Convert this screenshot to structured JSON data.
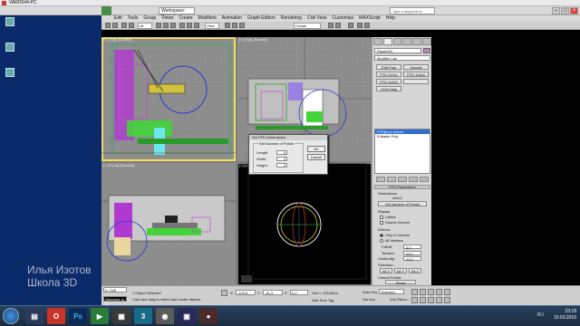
{
  "remote_window": {
    "title": "VARD644-PC"
  },
  "app": {
    "workspace": "Workspace: Default",
    "search_placeholder": "Type a keyword or phrase"
  },
  "menu": [
    "Edit",
    "Tools",
    "Group",
    "Views",
    "Create",
    "Modifiers",
    "Animation",
    "Graph Editors",
    "Rendering",
    "Civil View",
    "Customize",
    "MAXScript",
    "Help"
  ],
  "toolbar": {
    "selection_filter": "All",
    "view_dropdown": "View",
    "selection_set": "Create Selection Se"
  },
  "viewports": {
    "top_left": "[+] [Top] [Shaded]",
    "top_right": "[+] [Top] [Shaded]",
    "bottom_left": "[+] [Front] [Shaded]",
    "bottom_right": "[+] [Left] [Wireframe]",
    "left_strip_labels": [
      "[+] [Persp] [Default Shading]"
    ]
  },
  "command_panel": {
    "object_name": "Plane004",
    "modifier_list": "Modifier List",
    "buttons": [
      "Edit Poly",
      "Smooth",
      "FFD 2x2x2",
      "FFD 4x4x4",
      "FFD 3x3x3",
      "",
      "UVW Map"
    ],
    "stack": [
      {
        "label": "FFD(box) 4x4x4",
        "selected": true
      },
      {
        "label": "Editable Poly",
        "selected": false
      }
    ],
    "ffd_params": {
      "title": "FFD Parameters",
      "dimensions_label": "Dimensions:",
      "dims_value": "4x4x4",
      "set_points_button": "Set Number of Points",
      "display_label": "Display:",
      "lattice": "Lattice",
      "source_volume": "Source Volume",
      "deform_label": "Deform:",
      "only_in_volume": "Only In Volume",
      "all_vertices": "All Vertices",
      "falloff_label": "Falloff:",
      "falloff_value": "0,0",
      "tension_label": "Tension:",
      "tension_value": "25,0",
      "continuity_label": "Continuity:",
      "continuity_value": "25,0",
      "selection_label": "Selection:",
      "sel_buttons": [
        "All X",
        "All Y",
        "All Z"
      ],
      "control_points_label": "Control Points:",
      "reset_button": "Reset",
      "animate_all_button": "Animate All"
    }
  },
  "dialog": {
    "title": "Set FFD Dimensions",
    "group_label": "Set Number of Points",
    "length_label": "Length:",
    "length_value": "4",
    "width_label": "Width:",
    "width_value": "4",
    "height_label": "Height:",
    "height_value": "4",
    "ok": "OK",
    "cancel": "Cancel"
  },
  "status": {
    "frame": "0 / 100",
    "prompt": "Welcome to M",
    "selected": "1 Object Selected",
    "hint": "Click and drag to select and create objects",
    "x_value": "-109,8",
    "y_value": "-31,3",
    "z_value": "0,0",
    "grid": "Grid = 100,0mm",
    "add_time_tag": "Add Time Tag",
    "auto_key": "Auto Key",
    "set_key": "Set Key",
    "selected_dropdown": "Selected",
    "key_filters": "Key Filters..."
  },
  "watermark": {
    "line1": "Илья Изотов",
    "line2": "Школа 3D"
  },
  "taskbar": {
    "items": [
      "Ps",
      "",
      "",
      "",
      "",
      ""
    ],
    "lang": "RU",
    "time": "23:18",
    "date": "19.03.2016"
  }
}
